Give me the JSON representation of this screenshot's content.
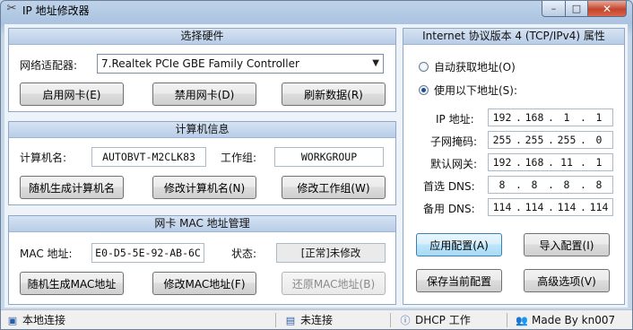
{
  "window": {
    "title": "IP 地址修改器",
    "minimize_glyph": "–",
    "maximize_glyph": "□",
    "close_glyph": "✕"
  },
  "hardware": {
    "heading": "选择硬件",
    "adapter_label": "网络适配器:",
    "adapter_value": "7.Realtek PCIe GBE Family Controller",
    "enable_button": "启用网卡(E)",
    "disable_button": "禁用网卡(D)",
    "refresh_button": "刷新数据(R)"
  },
  "computer": {
    "heading": "计算机信息",
    "name_label": "计算机名:",
    "name_value": "AUTOBVT-M2CLK83",
    "workgroup_label": "工作组:",
    "workgroup_value": "WORKGROUP",
    "random_name_button": "随机生成计算机名",
    "modify_name_button": "修改计算机名(N)",
    "modify_workgroup_button": "修改工作组(W)"
  },
  "mac": {
    "heading": "网卡 MAC 地址管理",
    "mac_label": "MAC 地址:",
    "mac_value": "E0-D5-5E-92-AB-6C",
    "status_label": "状态:",
    "status_value": "[正常]未修改",
    "random_mac_button": "随机生成MAC地址",
    "modify_mac_button": "修改MAC地址(F)",
    "restore_mac_button": "还原MAC地址(B)"
  },
  "ipv4": {
    "heading": "Internet 协议版本 4 (TCP/IPv4) 属性",
    "auto_option": "自动获取地址(O)",
    "manual_option": "使用以下地址(S):",
    "selected_option": "manual",
    "rows": [
      {
        "label": "IP 地址:",
        "octets": [
          "192",
          "168",
          "1",
          "1"
        ]
      },
      {
        "label": "子网掩码:",
        "octets": [
          "255",
          "255",
          "255",
          "0"
        ]
      },
      {
        "label": "默认网关:",
        "octets": [
          "192",
          "168",
          "11",
          "1"
        ]
      },
      {
        "label": "首选 DNS:",
        "octets": [
          "8",
          "8",
          "8",
          "8"
        ]
      },
      {
        "label": "备用 DNS:",
        "octets": [
          "114",
          "114",
          "114",
          "114"
        ]
      }
    ],
    "apply_button": "应用配置(A)",
    "import_button": "导入配置(I)",
    "save_button": "保存当前配置",
    "advanced_button": "高级选项(V)"
  },
  "statusbar": {
    "connection_name": "本地连接",
    "connection_state": "未连接",
    "dhcp_state": "DHCP 工作",
    "credit": "Made By kn007"
  },
  "icons": {
    "app": "tools-icon",
    "network": "network-icon",
    "disconnected": "disconnected-icon",
    "info": "info-icon",
    "users": "users-icon"
  },
  "colors": {
    "group_header": "#c6d7ec",
    "close_button": "#c3452c",
    "focus_button": "#bee6fd"
  }
}
